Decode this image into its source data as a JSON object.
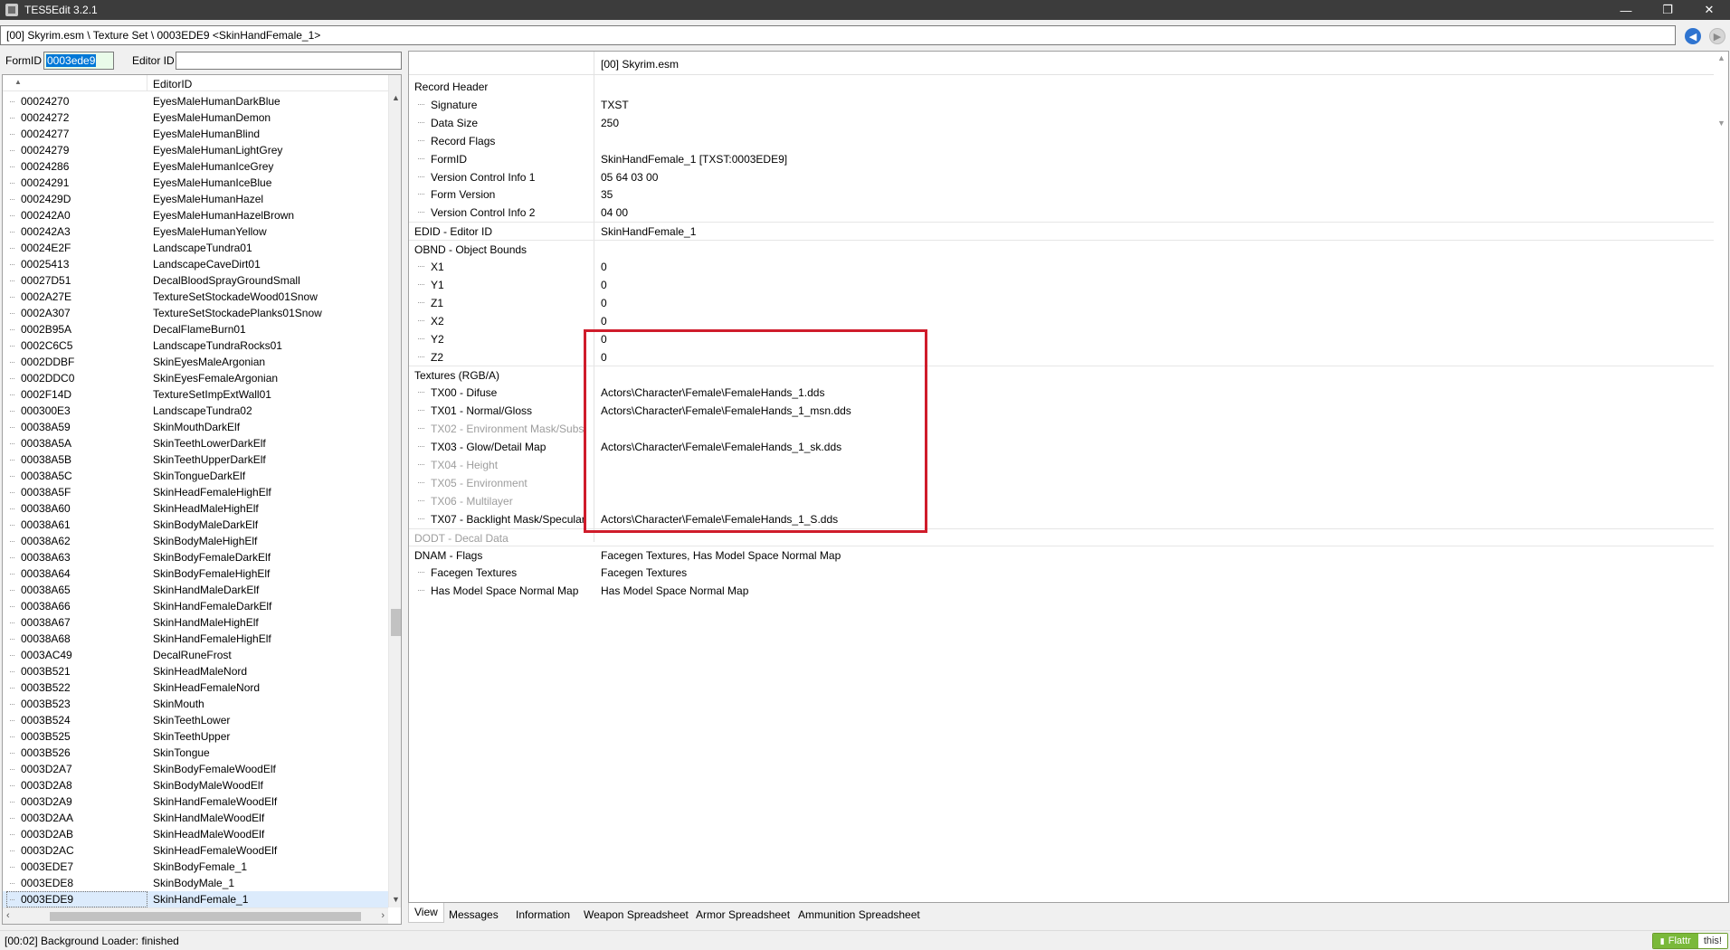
{
  "window": {
    "title": "TES5Edit 3.2.1",
    "buttons": [
      "—",
      "❐",
      "✕"
    ]
  },
  "path": "[00] Skyrim.esm \\ Texture Set \\ 0003EDE9 <SkinHandFemale_1>",
  "filter": {
    "formid_label": "FormID",
    "formid_value": "0003ede9",
    "editorid_label": "Editor ID",
    "editorid_value": ""
  },
  "left": {
    "col2_header": "EditorID",
    "rows": [
      {
        "id": "00024270",
        "name": "EyesMaleHumanDarkBlue"
      },
      {
        "id": "00024272",
        "name": "EyesMaleHumanDemon"
      },
      {
        "id": "00024277",
        "name": "EyesMaleHumanBlind"
      },
      {
        "id": "00024279",
        "name": "EyesMaleHumanLightGrey"
      },
      {
        "id": "00024286",
        "name": "EyesMaleHumanIceGrey"
      },
      {
        "id": "00024291",
        "name": "EyesMaleHumanIceBlue"
      },
      {
        "id": "0002429D",
        "name": "EyesMaleHumanHazel"
      },
      {
        "id": "000242A0",
        "name": "EyesMaleHumanHazelBrown"
      },
      {
        "id": "000242A3",
        "name": "EyesMaleHumanYellow"
      },
      {
        "id": "00024E2F",
        "name": "LandscapeTundra01"
      },
      {
        "id": "00025413",
        "name": "LandscapeCaveDirt01"
      },
      {
        "id": "00027D51",
        "name": "DecalBloodSprayGroundSmall"
      },
      {
        "id": "0002A27E",
        "name": "TextureSetStockadeWood01Snow"
      },
      {
        "id": "0002A307",
        "name": "TextureSetStockadePlanks01Snow"
      },
      {
        "id": "0002B95A",
        "name": "DecalFlameBurn01"
      },
      {
        "id": "0002C6C5",
        "name": "LandscapeTundraRocks01"
      },
      {
        "id": "0002DDBF",
        "name": "SkinEyesMaleArgonian"
      },
      {
        "id": "0002DDC0",
        "name": "SkinEyesFemaleArgonian"
      },
      {
        "id": "0002F14D",
        "name": "TextureSetImpExtWall01"
      },
      {
        "id": "000300E3",
        "name": "LandscapeTundra02"
      },
      {
        "id": "00038A59",
        "name": "SkinMouthDarkElf"
      },
      {
        "id": "00038A5A",
        "name": "SkinTeethLowerDarkElf"
      },
      {
        "id": "00038A5B",
        "name": "SkinTeethUpperDarkElf"
      },
      {
        "id": "00038A5C",
        "name": "SkinTongueDarkElf"
      },
      {
        "id": "00038A5F",
        "name": "SkinHeadFemaleHighElf"
      },
      {
        "id": "00038A60",
        "name": "SkinHeadMaleHighElf"
      },
      {
        "id": "00038A61",
        "name": "SkinBodyMaleDarkElf"
      },
      {
        "id": "00038A62",
        "name": "SkinBodyMaleHighElf"
      },
      {
        "id": "00038A63",
        "name": "SkinBodyFemaleDarkElf"
      },
      {
        "id": "00038A64",
        "name": "SkinBodyFemaleHighElf"
      },
      {
        "id": "00038A65",
        "name": "SkinHandMaleDarkElf"
      },
      {
        "id": "00038A66",
        "name": "SkinHandFemaleDarkElf"
      },
      {
        "id": "00038A67",
        "name": "SkinHandMaleHighElf"
      },
      {
        "id": "00038A68",
        "name": "SkinHandFemaleHighElf"
      },
      {
        "id": "0003AC49",
        "name": "DecalRuneFrost"
      },
      {
        "id": "0003B521",
        "name": "SkinHeadMaleNord"
      },
      {
        "id": "0003B522",
        "name": "SkinHeadFemaleNord"
      },
      {
        "id": "0003B523",
        "name": "SkinMouth"
      },
      {
        "id": "0003B524",
        "name": "SkinTeethLower"
      },
      {
        "id": "0003B525",
        "name": "SkinTeethUpper"
      },
      {
        "id": "0003B526",
        "name": "SkinTongue"
      },
      {
        "id": "0003D2A7",
        "name": "SkinBodyFemaleWoodElf"
      },
      {
        "id": "0003D2A8",
        "name": "SkinBodyMaleWoodElf"
      },
      {
        "id": "0003D2A9",
        "name": "SkinHandFemaleWoodElf"
      },
      {
        "id": "0003D2AA",
        "name": "SkinHandMaleWoodElf"
      },
      {
        "id": "0003D2AB",
        "name": "SkinHeadMaleWoodElf"
      },
      {
        "id": "0003D2AC",
        "name": "SkinHeadFemaleWoodElf"
      },
      {
        "id": "0003EDE7",
        "name": "SkinBodyFemale_1"
      },
      {
        "id": "0003EDE8",
        "name": "SkinBodyMale_1"
      },
      {
        "id": "0003EDE9",
        "name": "SkinHandFemale_1"
      }
    ],
    "selected_index": 49
  },
  "record": {
    "file_header": "[00] Skyrim.esm",
    "rows": [
      {
        "label": "Record Header",
        "value": "",
        "indent": 0
      },
      {
        "label": "Signature",
        "value": "TXST",
        "indent": 1
      },
      {
        "label": "Data Size",
        "value": "250",
        "indent": 1
      },
      {
        "label": "Record Flags",
        "value": "",
        "indent": 1
      },
      {
        "label": "FormID",
        "value": "SkinHandFemale_1 [TXST:0003EDE9]",
        "indent": 1
      },
      {
        "label": "Version Control Info 1",
        "value": "05 64 03 00",
        "indent": 1
      },
      {
        "label": "Form Version",
        "value": "35",
        "indent": 1
      },
      {
        "label": "Version Control Info 2",
        "value": "04 00",
        "indent": 1
      },
      {
        "label": "EDID - Editor ID",
        "value": "SkinHandFemale_1",
        "indent": 0,
        "sep": true
      },
      {
        "label": "OBND - Object Bounds",
        "value": "",
        "indent": 0,
        "sep": true
      },
      {
        "label": "X1",
        "value": "0",
        "indent": 1
      },
      {
        "label": "Y1",
        "value": "0",
        "indent": 1
      },
      {
        "label": "Z1",
        "value": "0",
        "indent": 1
      },
      {
        "label": "X2",
        "value": "0",
        "indent": 1
      },
      {
        "label": "Y2",
        "value": "0",
        "indent": 1
      },
      {
        "label": "Z2",
        "value": "0",
        "indent": 1
      },
      {
        "label": "Textures (RGB/A)",
        "value": "",
        "indent": 0,
        "sep": true
      },
      {
        "label": "TX00 - Difuse",
        "value": "Actors\\Character\\Female\\FemaleHands_1.dds",
        "indent": 1
      },
      {
        "label": "TX01 - Normal/Gloss",
        "value": "Actors\\Character\\Female\\FemaleHands_1_msn.dds",
        "indent": 1
      },
      {
        "label": "TX02 - Environment Mask/Subs",
        "value": "",
        "indent": 1,
        "dim": true
      },
      {
        "label": "TX03 - Glow/Detail Map",
        "value": "Actors\\Character\\Female\\FemaleHands_1_sk.dds",
        "indent": 1
      },
      {
        "label": "TX04 - Height",
        "value": "",
        "indent": 1,
        "dim": true
      },
      {
        "label": "TX05 - Environment",
        "value": "",
        "indent": 1,
        "dim": true
      },
      {
        "label": "TX06 - Multilayer",
        "value": "",
        "indent": 1,
        "dim": true
      },
      {
        "label": "TX07 - Backlight Mask/Specular",
        "value": "Actors\\Character\\Female\\FemaleHands_1_S.dds",
        "indent": 1
      },
      {
        "label": "DODT - Decal Data",
        "value": "",
        "indent": 0,
        "dim": true,
        "sep": true
      },
      {
        "label": "DNAM - Flags",
        "value": "Facegen Textures, Has Model Space Normal Map",
        "indent": 0,
        "sep": true
      },
      {
        "label": "Facegen Textures",
        "value": "Facegen Textures",
        "indent": 1
      },
      {
        "label": "Has Model Space Normal Map",
        "value": "Has Model Space Normal Map",
        "indent": 1
      }
    ]
  },
  "tabs": [
    "View",
    "Messages",
    "Information",
    "Weapon Spreadsheet",
    "Armor Spreadsheet",
    "Ammunition Spreadsheet"
  ],
  "active_tab": "View",
  "status": "[00:02] Background Loader: finished",
  "flattr": {
    "left": "Flattr",
    "right": "this!"
  },
  "colors": {
    "highlight": "#cf1c2b",
    "selection": "#dcebfc",
    "titlebar": "#3c3c3c"
  }
}
